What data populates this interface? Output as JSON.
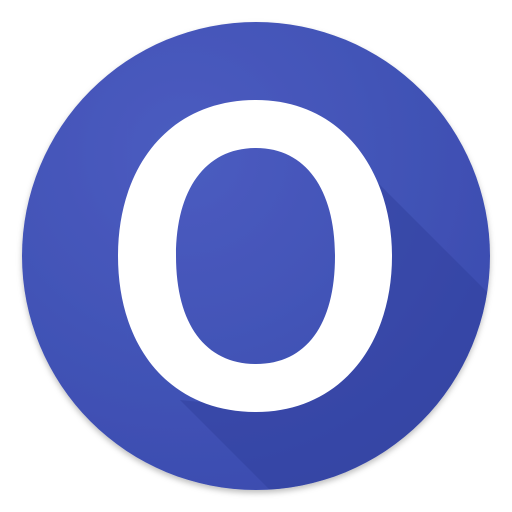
{
  "icon": {
    "name": "app-launcher-icon",
    "letter": "O",
    "colors": {
      "circle": "#3F51B5",
      "circle_highlight": "#4A5BBE",
      "long_shadow": "#33449E",
      "glyph": "#FFFFFF",
      "glyph_inner": "#3D4FB1"
    }
  }
}
